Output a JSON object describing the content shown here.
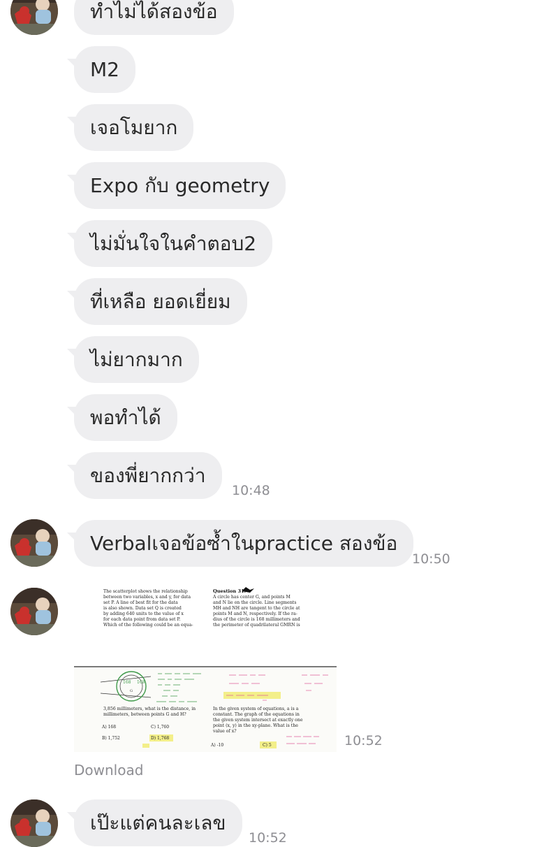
{
  "chat": {
    "messages": [
      {
        "text": "ทำไม่ได้สองข้อ"
      },
      {
        "text": "M2"
      },
      {
        "text": "เจอโมยาก"
      },
      {
        "text": "Expo กับ geometry"
      },
      {
        "text": "ไม่มั่นใจในคำตอบ2"
      },
      {
        "text": "ที่เหลือ ยอดเยี่ยม"
      },
      {
        "text": "ไม่ยากมาก"
      },
      {
        "text": "พอทำได้"
      },
      {
        "text": "ของพี่ยากกว่า",
        "time": "10:48"
      },
      {
        "text": "Verbalเจอข้อซ้ำในpractice สองข้อ",
        "time": "10:50"
      },
      {
        "image": "exam-photo",
        "time": "10:52",
        "download_label": "Download"
      },
      {
        "text": "เป๊ะแต่คนละเลข",
        "time": "10:52"
      }
    ]
  },
  "exam_image": {
    "q31_label": "Question 31.",
    "left_col": [
      "The scatterplot shows the relationship",
      "between two variables, x and y, for data",
      "set P. A line of best fit for the data",
      "is also shown. Data set Q is created",
      "by adding 640 units to the value of x",
      "for each data point from data set P.",
      "Which of the following could be an equa-"
    ],
    "right_col": [
      "A circle has center G, and points M",
      "and N lie on the circle. Line segments",
      "MH and NH are tangent to the circle at",
      "points M and N, respectively. If the ra-",
      "dius of the circle is 168 millimeters and",
      "the perimeter of quadrilateral GMRN is"
    ],
    "bottom_left": [
      "3,856 millimeters, what is the distance, in",
      "millimeters, between points G and H?"
    ],
    "choices_left": [
      "A) 168",
      "C) 1,760",
      "B) 1,752",
      "D) 1,768"
    ],
    "bottom_right": [
      "In the given system of equations, a is a",
      "constant. The graph of the equations in",
      "the given system intersect at exactly one",
      "point (x, y) in the xy-plane. What is the",
      "value of x?"
    ],
    "choices_right": [
      "A) -10",
      "C) 5"
    ],
    "circle_labels": [
      "168",
      "168",
      "G"
    ]
  },
  "colors": {
    "bubble_bg": "#eeeef0",
    "text": "#2a2a2a",
    "meta": "#8e8e93",
    "highlight": "#f3ef8a",
    "pink_ink": "#e0609a",
    "green_ink": "#3f9a4a"
  }
}
